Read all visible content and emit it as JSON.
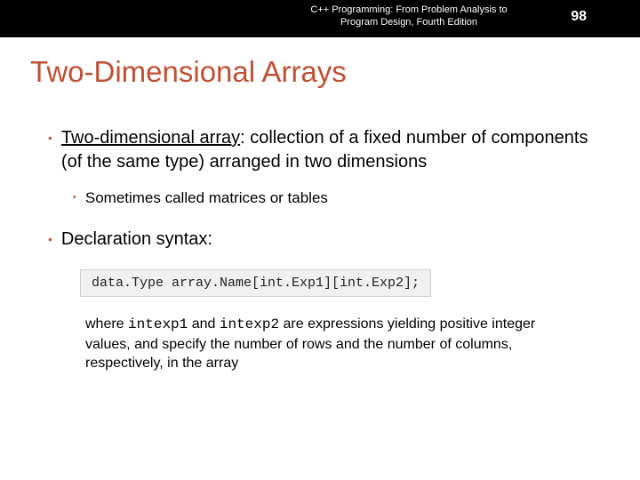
{
  "header": {
    "book": "C++ Programming: From Problem Analysis to Program Design, Fourth Edition",
    "page": "98"
  },
  "slide": {
    "title": "Two-Dimensional Arrays",
    "bullets": [
      {
        "level": 1,
        "term": "Two-dimensional array",
        "rest": ": collection of a fixed number of components (of the same type) arranged in two dimensions"
      },
      {
        "level": 2,
        "text": "Sometimes called matrices or tables"
      },
      {
        "level": 1,
        "text": "Declaration syntax:"
      }
    ],
    "syntax": "data.Type  array.Name[int.Exp1][int.Exp2];",
    "where": {
      "pre": "where ",
      "code1": "intexp1",
      "mid1": " and ",
      "code2": "intexp2",
      "post": " are expressions yielding positive integer values, and specify the number of rows and the number of columns, respectively, in the array"
    }
  }
}
